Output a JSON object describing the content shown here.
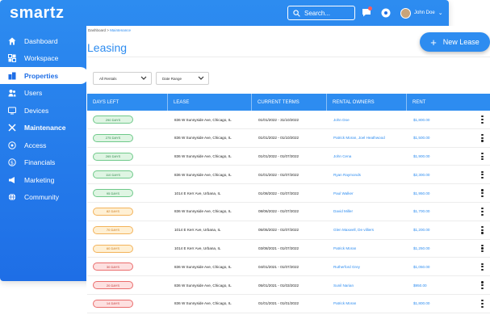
{
  "app": {
    "logo": "smartz"
  },
  "topbar": {
    "search_label": "Search...",
    "user_name": "John Doe",
    "user_caret": "⌄"
  },
  "sidebar": {
    "items": [
      {
        "label": "Dashboard",
        "icon": "home-icon"
      },
      {
        "label": "Workspace",
        "icon": "workspace-icon"
      },
      {
        "label": "Properties",
        "icon": "building-icon",
        "active": true
      },
      {
        "label": "Users",
        "icon": "users-icon"
      },
      {
        "label": "Devices",
        "icon": "devices-icon"
      },
      {
        "label": "Maintenance",
        "icon": "tools-icon"
      },
      {
        "label": "Access",
        "icon": "access-icon"
      },
      {
        "label": "Financials",
        "icon": "dollar-icon"
      },
      {
        "label": "Marketing",
        "icon": "marketing-icon"
      },
      {
        "label": "Community",
        "icon": "globe-icon"
      }
    ]
  },
  "breadcrumb": {
    "root": "Dashboard",
    "sep": ">",
    "current": "Maintenance"
  },
  "page": {
    "title": "Leasing",
    "new_button": "New Lease"
  },
  "filters": {
    "rentals": "All Rentals",
    "date": "Date Range"
  },
  "table": {
    "headers": [
      "DAYS LEFT",
      "LEASE",
      "CURRENT TERMS",
      "RENTAL OWNERS",
      "RENT"
    ],
    "rows": [
      {
        "days": "290 DAYS",
        "status": "green",
        "lease": "836 W Sunnyside Ave, Chicago, IL",
        "terms": "01/01/2022 - 31/10/2022",
        "owner": "John Doe",
        "rent": "$1,800.00"
      },
      {
        "days": "275 DAYS",
        "status": "green",
        "lease": "836 W Sunnyside Ave, Chicago, IL",
        "terms": "01/01/2022 - 01/10/2022",
        "owner": "Patrick Moran, Joel Heathwood",
        "rent": "$1,500.00"
      },
      {
        "days": "265 DAYS",
        "status": "green",
        "lease": "836 W Sunnyside Ave, Chicago, IL",
        "terms": "01/01/2022 - 01/07/2022",
        "owner": "John Cena",
        "rent": "$1,900.00"
      },
      {
        "days": "110 DAYS",
        "status": "green",
        "lease": "836 W Sunnyside Ave, Chicago, IL",
        "terms": "01/01/2022 - 01/07/2022",
        "owner": "Ryan Raymonds",
        "rent": "$2,300.00"
      },
      {
        "days": "95 DAYS",
        "status": "green",
        "lease": "1014 E Kerr Ave, Urbana, IL",
        "terms": "01/08/2022 - 01/07/2022",
        "owner": "Paul Walker",
        "rent": "$1,950.00"
      },
      {
        "days": "82 DAYS",
        "status": "orange",
        "lease": "836 W Sunnyside Ave, Chicago, IL",
        "terms": "08/06/2022 - 01/07/2022",
        "owner": "David Miller",
        "rent": "$1,700.00"
      },
      {
        "days": "70 DAYS",
        "status": "orange",
        "lease": "1014 E Kerr Ave, Urbana, IL",
        "terms": "05/05/2022 - 01/07/2022",
        "owner": "Glen Maxwell, De villiers",
        "rent": "$1,200.00"
      },
      {
        "days": "60 DAYS",
        "status": "orange",
        "lease": "1014 E Kerr Ave, Urbana, IL",
        "terms": "03/08/2021 - 01/07/2022",
        "owner": "Patrick Moran",
        "rent": "$1,250.00"
      },
      {
        "days": "30 DAYS",
        "status": "red",
        "lease": "836 W Sunnyside Ave, Chicago, IL",
        "terms": "04/01/2021 - 01/07/2022",
        "owner": "Rutherford Grey",
        "rent": "$1,050.00"
      },
      {
        "days": "20 DAYS",
        "status": "red",
        "lease": "836 W Sunnyside Ave, Chicago, IL",
        "terms": "05/01/2021 - 01/03/2022",
        "owner": "Sunil Narian",
        "rent": "$950.00"
      },
      {
        "days": "14 DAYS",
        "status": "red",
        "lease": "836 W Sunnyside Ave, Chicago, IL",
        "terms": "01/01/2021 - 01/01/2022",
        "owner": "Patrick Moran",
        "rent": "$1,800.00"
      }
    ]
  },
  "colors": {
    "brand": "#2d8cf0",
    "sidebar_bg": "#1e6ee6",
    "badge_green": "#6fc98a",
    "badge_orange": "#f3b35a",
    "badge_red": "#ea6c6c"
  }
}
